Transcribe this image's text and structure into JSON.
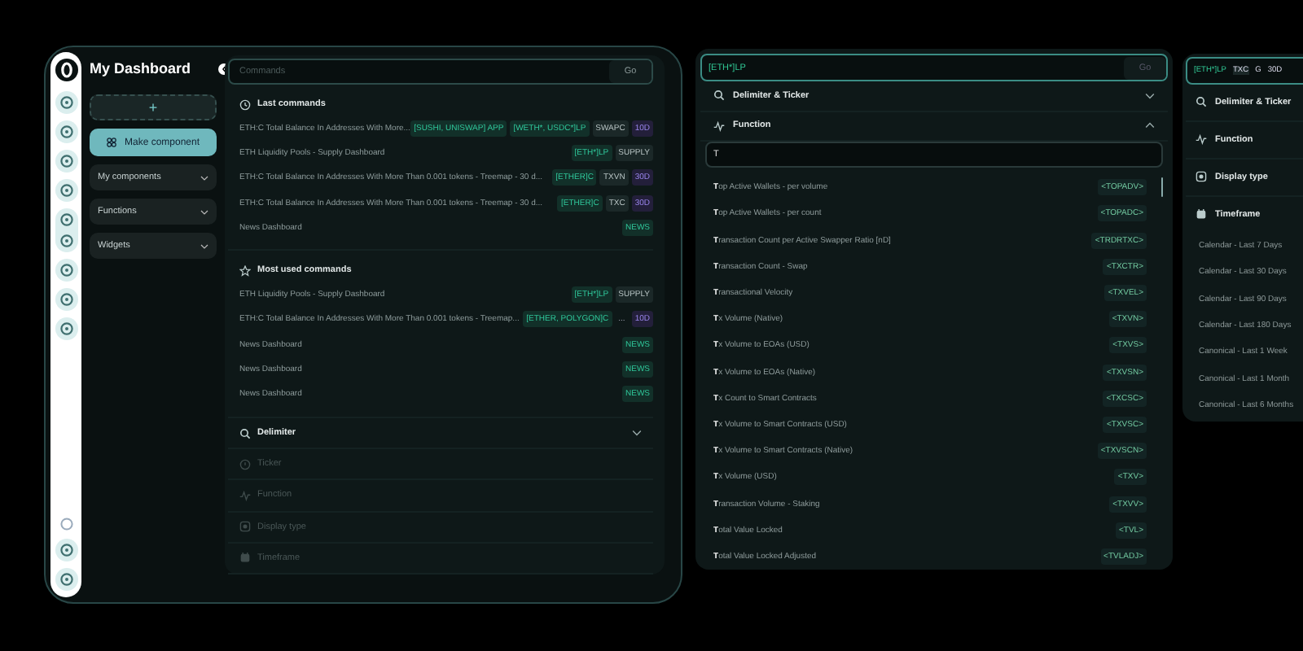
{
  "sidebar": {
    "title": "My Dashboard",
    "add_button": "+",
    "make_button": "Make component",
    "menus": [
      {
        "label": "My components",
        "expanded": false
      },
      {
        "label": "Functions",
        "expanded": false
      },
      {
        "label": "Widgets",
        "expanded": false
      }
    ]
  },
  "commands_panel": {
    "search": {
      "placeholder": "Commands"
    },
    "go": "Go",
    "groups": [
      {
        "title": "Last commands",
        "kind": "recent",
        "rows": [
          {
            "text": "ETH:C Total Balance In Addresses With More...",
            "tags": [
              {
                "text": "[SUSHI, UNISWAP] APP",
                "kind": "token"
              },
              {
                "text": "[WETH*, USDC*]LP",
                "kind": "token"
              },
              {
                "text": "SWAPC",
                "kind": "plain"
              },
              {
                "text": "10D",
                "kind": "period"
              }
            ]
          },
          {
            "text": "ETH Liquidity Pools - Supply Dashboard",
            "tags": [
              {
                "text": "[ETH*]LP",
                "kind": "token"
              },
              {
                "text": "SUPPLY",
                "kind": "plain"
              }
            ]
          },
          {
            "text": "ETH:C Total Balance In Addresses With More Than 0.001 tokens - Treemap - 30 d...",
            "tags": [
              {
                "text": "[ETHER]C",
                "kind": "token"
              },
              {
                "text": "TXVN",
                "kind": "plain"
              },
              {
                "text": "30D",
                "kind": "period"
              }
            ]
          },
          {
            "text": "ETH:C Total Balance In Addresses With More Than 0.001 tokens - Treemap - 30 d...",
            "tags": [
              {
                "text": "[ETHER]C",
                "kind": "token"
              },
              {
                "text": "TXC",
                "kind": "plain"
              },
              {
                "text": "30D",
                "kind": "period"
              }
            ]
          },
          {
            "text": "News Dashboard",
            "tags": [
              {
                "text": "NEWS",
                "kind": "token"
              }
            ]
          }
        ]
      },
      {
        "title": "Most used commands",
        "kind": "popular",
        "rows": [
          {
            "text": "ETH Liquidity Pools - Supply Dashboard",
            "tags": [
              {
                "text": "[ETH*]LP",
                "kind": "token"
              },
              {
                "text": "SUPPLY",
                "kind": "plain"
              }
            ]
          },
          {
            "text": "ETH:C Total Balance In Addresses With More Than 0.001 tokens - Treemap...",
            "tags": [
              {
                "text": "[ETHER, POLYGON]C",
                "kind": "token"
              },
              {
                "text": "...",
                "kind": "more"
              },
              {
                "text": "10D",
                "kind": "period"
              }
            ]
          },
          {
            "text": "News Dashboard",
            "tags": [
              {
                "text": "NEWS",
                "kind": "token"
              }
            ]
          },
          {
            "text": "News Dashboard",
            "tags": [
              {
                "text": "NEWS",
                "kind": "token"
              }
            ]
          },
          {
            "text": "News Dashboard",
            "tags": [
              {
                "text": "NEWS",
                "kind": "token"
              }
            ]
          }
        ]
      }
    ],
    "steps": [
      {
        "label": "Delimiter",
        "disabled": false,
        "expanded": false
      },
      {
        "label": "Ticker",
        "disabled": true
      },
      {
        "label": "Function",
        "disabled": true
      },
      {
        "label": "Display type",
        "disabled": true
      },
      {
        "label": "Timeframe",
        "disabled": true
      }
    ]
  },
  "function_panel": {
    "query": {
      "value": "[ETH*]LP"
    },
    "go": "Go",
    "sections": [
      {
        "label": "Delimiter & Ticker",
        "expanded": false
      },
      {
        "label": "Function",
        "expanded": true
      }
    ],
    "filter": {
      "value": "T"
    },
    "functions": [
      {
        "name": "**T**op Active Wallets - per volume",
        "code": "<TOPADV>"
      },
      {
        "name": "**T**op Active Wallets - per count",
        "code": "<TOPADC>"
      },
      {
        "name": "**T**ransaction Count per Active Swapper Ratio [nD]",
        "code": "<TRDRTXC>"
      },
      {
        "name": "**T**ransaction Count - Swap",
        "code": "<TXCTR>"
      },
      {
        "name": "**T**ransactional Velocity",
        "code": "<TXVEL>"
      },
      {
        "name": "**T**x Volume (Native)",
        "code": "<TXVN>"
      },
      {
        "name": "**T**x Volume to EOAs (USD)",
        "code": "<TXVS>"
      },
      {
        "name": "**T**x Volume to EOAs (Native)",
        "code": "<TXVSN>"
      },
      {
        "name": "**T**x Count to Smart Contracts",
        "code": "<TXCSC>"
      },
      {
        "name": "**T**x Volume to Smart Contracts (USD)",
        "code": "<TXVSC>"
      },
      {
        "name": "**T**x Volume to Smart Contracts (Native)",
        "code": "<TXVSCN>"
      },
      {
        "name": "**T**x Volume (USD)",
        "code": "<TXV>"
      },
      {
        "name": "**T**ransaction Volume - Staking",
        "code": "<TXVV>"
      },
      {
        "name": "**T**otal Value Locked",
        "code": "<TVL>"
      },
      {
        "name": "**T**otal Value Locked Adjusted",
        "code": "<TVLADJ>"
      }
    ]
  },
  "timeframe_panel": {
    "query_tokens": [
      {
        "text": "[ETH*]LP",
        "kind": "token"
      },
      {
        "text": "TXC",
        "kind": "plain"
      },
      {
        "text": "G",
        "kind": "display"
      },
      {
        "text": "30D",
        "kind": "period"
      }
    ],
    "sections": [
      "Delimiter & Ticker",
      "Function",
      "Display type",
      "Timeframe"
    ],
    "timeframes": [
      "Calendar - Last 7 Days",
      "Calendar - Last 30 Days",
      "Calendar - Last 90 Days",
      "Calendar - Last 180 Days",
      "Canonical - Last 1 Week",
      "Canonical - Last 1 Month",
      "Canonical - Last 6 Months"
    ]
  }
}
